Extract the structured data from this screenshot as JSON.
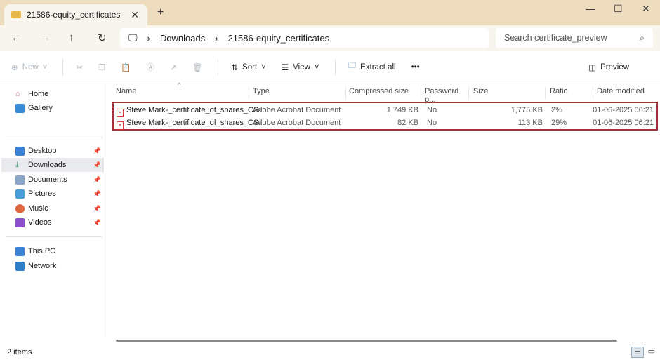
{
  "window": {
    "tab_title": "21586-equity_certificates",
    "new_tab": "+",
    "minimize": "—",
    "maximize": "☐",
    "close": "✕"
  },
  "nav": {
    "back": "←",
    "forward": "→",
    "up": "↑",
    "refresh": "↻"
  },
  "breadcrumb": [
    "Downloads",
    "21586-equity_certificates"
  ],
  "search": {
    "placeholder": "Search certificate_preview"
  },
  "toolbar": {
    "new": "New",
    "sort": "Sort",
    "view": "View",
    "extract_all": "Extract all",
    "more": "•••",
    "preview": "Preview"
  },
  "sidebar": {
    "items": [
      {
        "label": "Home"
      },
      {
        "label": "Gallery"
      },
      {
        "label": "Desktop"
      },
      {
        "label": "Downloads"
      },
      {
        "label": "Documents"
      },
      {
        "label": "Pictures"
      },
      {
        "label": "Music"
      },
      {
        "label": "Videos"
      },
      {
        "label": "This PC"
      },
      {
        "label": "Network"
      }
    ]
  },
  "columns": [
    "Name",
    "Type",
    "Compressed size",
    "Password p...",
    "Size",
    "Ratio",
    "Date modified"
  ],
  "files": [
    {
      "name": "Steve Mark-_certificate_of_shares_CS-",
      "type": "Adobe Acrobat Document",
      "compressed": "1,749 KB",
      "password": "No",
      "size": "1,775 KB",
      "ratio": "2%",
      "date": "01-06-2025 06:21"
    },
    {
      "name": "Steve Mark-_certificate_of_shares_CS-",
      "type": "Adobe Acrobat Document",
      "compressed": "82 KB",
      "password": "No",
      "size": "113 KB",
      "ratio": "29%",
      "date": "01-06-2025 06:21"
    }
  ],
  "status": {
    "count": "2 items"
  }
}
